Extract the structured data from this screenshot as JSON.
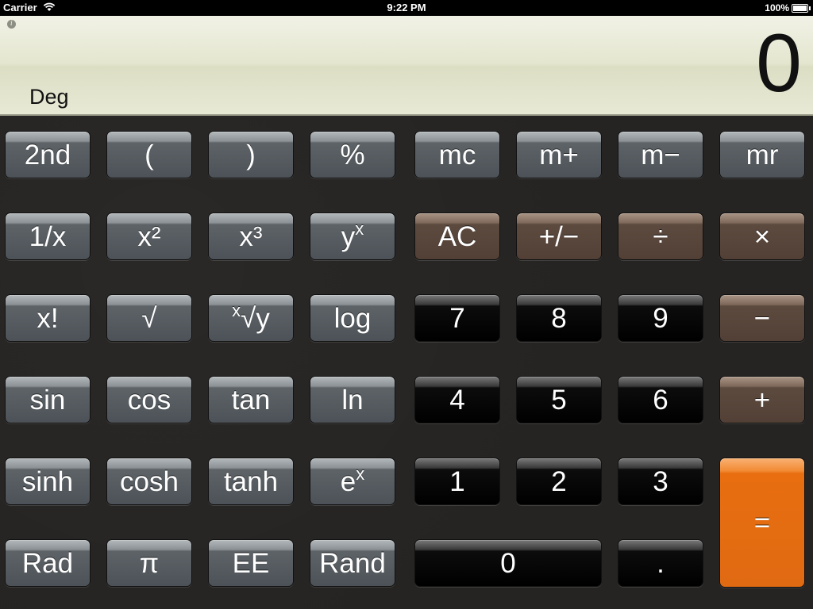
{
  "status_bar": {
    "carrier": "Carrier",
    "time": "9:22 PM",
    "battery": "100%",
    "icons": [
      "wifi-icon",
      "battery-icon"
    ]
  },
  "display": {
    "info_icon_glyph": "i",
    "angle_mode": "Deg",
    "value": "0",
    "background": "#e4e6cf"
  },
  "colors": {
    "function_key": "#4c5257",
    "operator_key": "#5d4a3f",
    "digit_key": "#000000",
    "equals_key": "#e86e10"
  },
  "keys": {
    "second": "2nd",
    "open_paren": "(",
    "close_paren": ")",
    "percent": "%",
    "mc": "mc",
    "m_plus": "m+",
    "m_minus": "m−",
    "mr": "mr",
    "reciprocal": "1/x",
    "square": "x²",
    "cube": "x³",
    "power_base": "y",
    "power_exp": "x",
    "clear": "AC",
    "plus_minus": "+/−",
    "divide": "÷",
    "multiply": "×",
    "factorial": "x!",
    "sqrt": "√",
    "root_index": "x",
    "root_body": "√y",
    "log": "log",
    "d7": "7",
    "d8": "8",
    "d9": "9",
    "minus": "−",
    "sin": "sin",
    "cos": "cos",
    "tan": "tan",
    "ln": "ln",
    "d4": "4",
    "d5": "5",
    "d6": "6",
    "plus": "+",
    "sinh": "sinh",
    "cosh": "cosh",
    "tanh": "tanh",
    "exp_base": "e",
    "exp_exp": "x",
    "d1": "1",
    "d2": "2",
    "d3": "3",
    "equals": "=",
    "rad": "Rad",
    "pi": "π",
    "ee": "EE",
    "rand": "Rand",
    "d0": "0",
    "decimal": "."
  }
}
